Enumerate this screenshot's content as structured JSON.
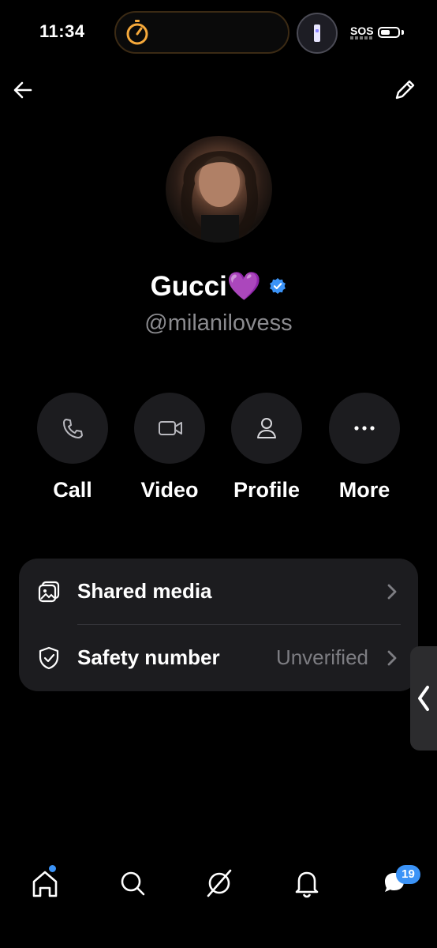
{
  "status_bar": {
    "time": "11:34",
    "sos": "SOS",
    "battery_level": 0.5
  },
  "header": {
    "back_icon": "arrow-left-icon",
    "edit_icon": "pencil-icon"
  },
  "profile": {
    "name": "Gucci💜",
    "handle": "@milanilovess",
    "verified": true,
    "accent": "#3b93f7"
  },
  "actions": [
    {
      "label": "Call",
      "icon": "phone-icon"
    },
    {
      "label": "Video",
      "icon": "video-camera-icon"
    },
    {
      "label": "Profile",
      "icon": "person-icon"
    },
    {
      "label": "More",
      "icon": "ellipsis-icon"
    }
  ],
  "settings": [
    {
      "label": "Shared media",
      "value": "",
      "icon": "media-icon"
    },
    {
      "label": "Safety number",
      "value": "Unverified",
      "icon": "shield-check-icon"
    }
  ],
  "bottom_nav": {
    "items": [
      "home-icon",
      "search-icon",
      "grok-icon",
      "bell-icon",
      "messages-icon"
    ],
    "messages_badge": "19"
  }
}
